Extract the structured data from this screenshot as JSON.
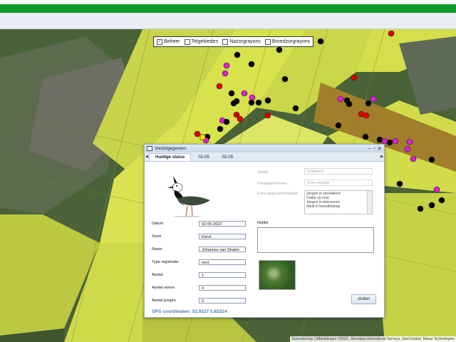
{
  "layers": [
    {
      "label": "Beheer",
      "checked": true
    },
    {
      "label": "Telgebieden",
      "checked": false
    },
    {
      "label": "Nazorgrayons",
      "checked": false
    },
    {
      "label": "Broedzorgrayons",
      "checked": false
    }
  ],
  "attribution": "Gereedschap | Afbeeldingen ©2023 , Aerodata International Surveys, GeoContent, Maxar Technologies",
  "dialog": {
    "title": "Vondstgegevens",
    "tabs": [
      {
        "label": "Huidige status",
        "active": true
      },
      {
        "label": "02-05",
        "active": false
      },
      {
        "label": "02-05",
        "active": false
      }
    ],
    "fields": [
      {
        "label": "Datum",
        "value": "02-05-2023"
      },
      {
        "label": "Soort",
        "value": "Kievit"
      },
      {
        "label": "Naam",
        "value": "Johannes van Stralen"
      },
      {
        "label": "Type registratie",
        "value": "nest"
      },
      {
        "label": "Aantal",
        "value": "1"
      },
      {
        "label": "Aantal eieren",
        "value": "4"
      },
      {
        "label": "Aantal jongen",
        "value": "0"
      }
    ],
    "status_label": "Status",
    "status_value": "Onbekend",
    "predatie_label": "Predatie/verloren",
    "predatie_value": "Geen predatie",
    "extra_label": "Extra gegevens/habitat",
    "extra_options": [
      "Jongen in verenkleed",
      "Ouder op nest",
      "Jongen in donsveren",
      "Adult in broedbiotoop"
    ],
    "notes_label": "Notitie",
    "close_label": "sluiten",
    "gps_text": "GPS coordinaten: 52.9227 5.82314"
  },
  "colors": {
    "marker_red": "#e00000",
    "marker_magenta": "#e020d0",
    "marker_black": "#000000",
    "marker_yellow": "#ffe000",
    "brand_green": "#0e9a2a"
  }
}
